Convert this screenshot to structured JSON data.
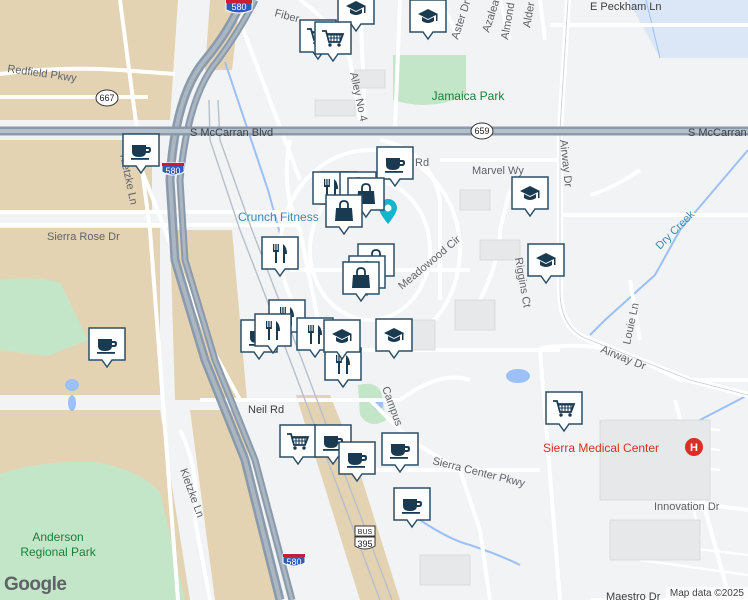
{
  "map": {
    "roads": {
      "mccarran": "S McCarran Blvd",
      "mccarran_e": "S McCarran",
      "peckham": "E Peckham Ln",
      "fiber": "Fiber",
      "aster": "Aster Dr",
      "azalea": "Azalea",
      "almond": "Almond Dr",
      "alder": "Alder",
      "alley4": "Alley No 4",
      "redfield": "Redfield Pkwy",
      "kietzke": "Kietzke Ln",
      "kietzke_s": "Kietzke Ln",
      "sierra_rose": "Sierra Rose Dr",
      "marvel": "Marvel Wy",
      "airway": "Airway Dr",
      "airway_s": "Airway Dr",
      "meadowood": "Meadowood Cir",
      "riggins": "Riggins Ct",
      "louie": "Louie Ln",
      "neil": "Neil Rd",
      "campus": "Campus",
      "sierra_center": "Sierra Center Pkwy",
      "innovation": "Innovation Dr",
      "maestro": "Maestro Dr",
      "rd": "Rd"
    },
    "shields": {
      "i580_top": "580",
      "i580_mid": "580",
      "i580_bot": "580",
      "hwy667": "667",
      "hwy659": "659",
      "us395": "395",
      "bus": "BUS"
    },
    "places": {
      "jamaica_park": "Jamaica Park",
      "dry_creek": "Dry Creek",
      "crunch": "Crunch Fitness",
      "sierra_medical": "Sierra Medical Center",
      "anderson_1": "Anderson",
      "anderson_2": "Regional Park",
      "hospital_symbol": "H"
    },
    "brand": "Google",
    "attribution": "Map data ©2025",
    "colors": {
      "background": "#f1f3f4",
      "commercial": "#e3d3b3",
      "park": "#c3e6c9",
      "water": "#9cc0f9",
      "highway": "#8a9aab",
      "pin_border": "#2b4f67",
      "hospital": "#d93025",
      "park_label": "#188038",
      "water_label": "#3e8bb1"
    },
    "markers": [
      {
        "icon": "education"
      },
      {
        "icon": "education"
      },
      {
        "icon": "shopping"
      },
      {
        "icon": "shopping"
      },
      {
        "icon": "cafe"
      },
      {
        "icon": "cafe"
      },
      {
        "icon": "shopping"
      },
      {
        "icon": "restaurant"
      },
      {
        "icon": "shopping"
      },
      {
        "icon": "shopping"
      },
      {
        "icon": "shopping"
      },
      {
        "icon": "education"
      },
      {
        "icon": "restaurant"
      },
      {
        "icon": "shopping"
      },
      {
        "icon": "education"
      },
      {
        "icon": "shopping"
      },
      {
        "icon": "shopping"
      },
      {
        "icon": "restaurant"
      },
      {
        "icon": "restaurant"
      },
      {
        "icon": "cafe"
      },
      {
        "icon": "restaurant"
      },
      {
        "icon": "education"
      },
      {
        "icon": "education"
      },
      {
        "icon": "restaurant"
      },
      {
        "icon": "cafe"
      },
      {
        "icon": "shopping"
      },
      {
        "icon": "shopping"
      },
      {
        "icon": "cafe"
      },
      {
        "icon": "cafe"
      },
      {
        "icon": "cafe"
      },
      {
        "icon": "cafe"
      }
    ]
  }
}
